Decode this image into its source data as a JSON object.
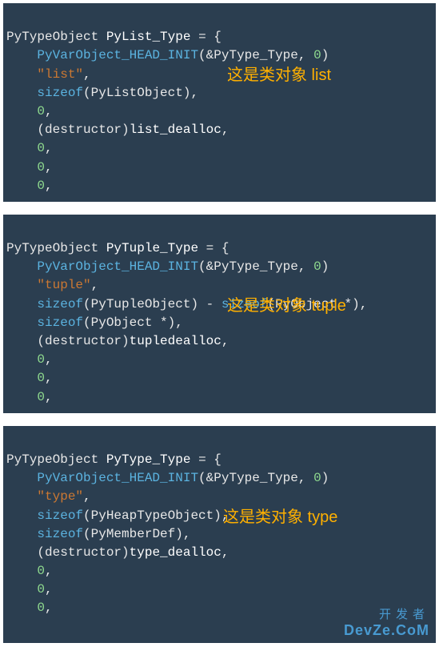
{
  "blocks": [
    {
      "decl_type": "PyTypeObject",
      "decl_name": "PyList_Type",
      "head_macro": "PyVarObject_HEAD_INIT",
      "head_arg1": "&PyType_Type",
      "head_arg2": "0",
      "name_string": "\"list\"",
      "size_expr_prefix": "sizeof",
      "size_expr_arg": "PyListObject",
      "extra_size": null,
      "zero1": "0",
      "destructor_cast": "destructor",
      "destructor_name": "list_dealloc",
      "tail_zeros": [
        "0",
        "0",
        "0"
      ],
      "annotation": "这是类对象 list"
    },
    {
      "decl_type": "PyTypeObject",
      "decl_name": "PyTuple_Type",
      "head_macro": "PyVarObject_HEAD_INIT",
      "head_arg1": "&PyType_Type",
      "head_arg2": "0",
      "name_string": "\"tuple\"",
      "size_expr_prefix": "sizeof",
      "size_expr_arg": "PyTupleObject",
      "size_minus_prefix": "sizeof",
      "size_minus_arg": "PyObject *",
      "extra_size_prefix": "sizeof",
      "extra_size_arg": "PyObject *",
      "destructor_cast": "destructor",
      "destructor_name": "tupledealloc",
      "tail_zeros": [
        "0",
        "0",
        "0"
      ],
      "annotation": "这是类对象 tuple"
    },
    {
      "decl_type": "PyTypeObject",
      "decl_name": "PyType_Type",
      "head_macro": "PyVarObject_HEAD_INIT",
      "head_arg1": "&PyType_Type",
      "head_arg2": "0",
      "name_string": "\"type\"",
      "size_expr_prefix": "sizeof",
      "size_expr_arg": "PyHeapTypeObject",
      "extra_size_prefix": "sizeof",
      "extra_size_arg": "PyMemberDef",
      "destructor_cast": "destructor",
      "destructor_name": "type_dealloc",
      "tail_zeros": [
        "0",
        "0",
        "0"
      ],
      "annotation": "这是类对象 type"
    }
  ],
  "watermark": {
    "line1": "开发者",
    "line2": "DevZe.CoM"
  }
}
